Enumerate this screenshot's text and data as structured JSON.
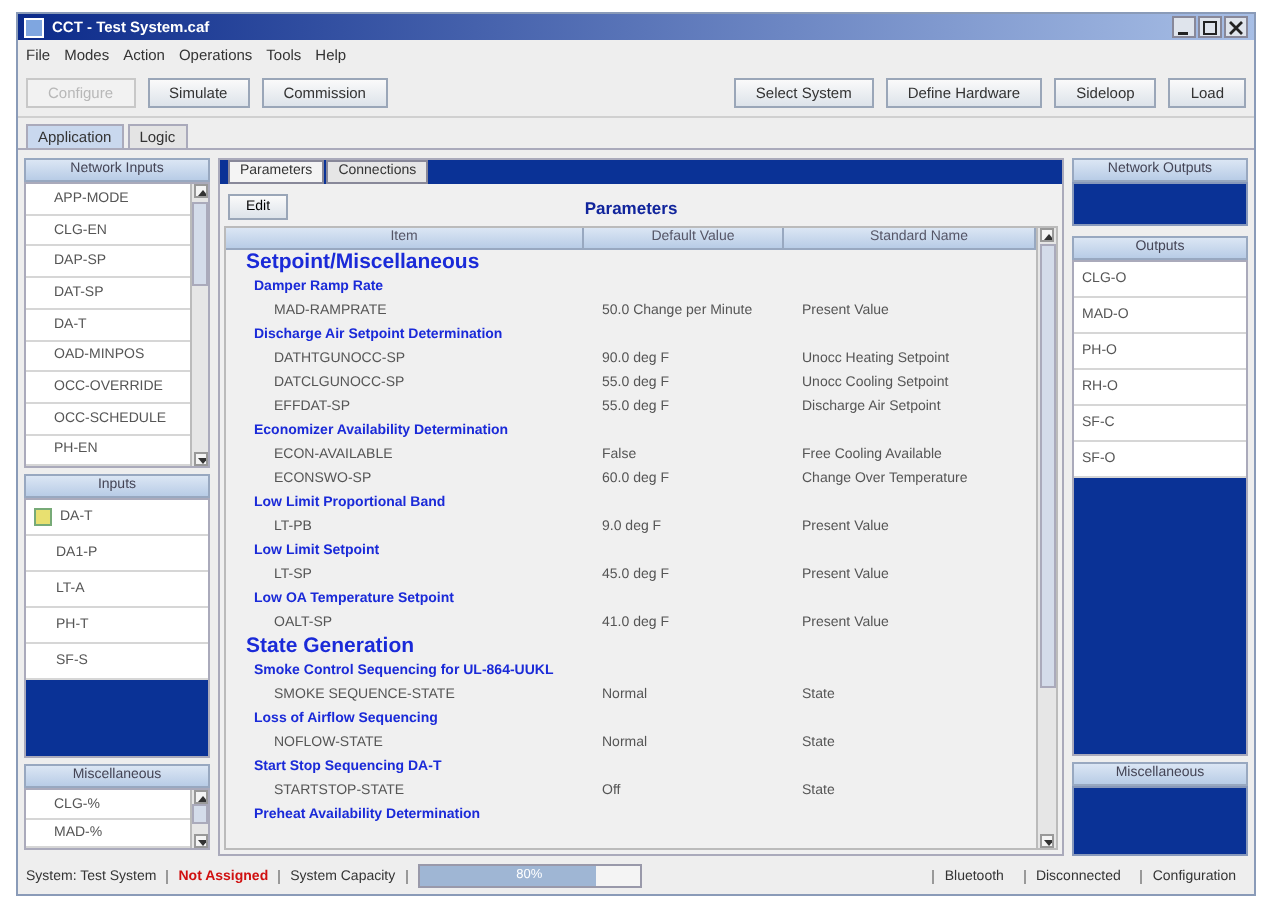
{
  "window": {
    "title": "CCT - Test System.caf"
  },
  "menu": [
    "File",
    "Modes",
    "Action",
    "Operations",
    "Tools",
    "Help"
  ],
  "toolbar_left": [
    {
      "label": "Configure",
      "disabled": true
    },
    {
      "label": "Simulate",
      "disabled": false
    },
    {
      "label": "Commission",
      "disabled": false
    }
  ],
  "toolbar_right": [
    "Select System",
    "Define Hardware",
    "Sideloop",
    "Load"
  ],
  "tabs": [
    {
      "label": "Application",
      "selected": true
    },
    {
      "label": "Logic",
      "selected": false
    }
  ],
  "left_panel": {
    "network_inputs": {
      "title": "Network Inputs",
      "items": [
        "APP-MODE",
        "CLG-EN",
        "DAP-SP",
        "DAT-SP",
        "DA-T",
        "OAD-MINPOS",
        "OCC-OVERRIDE",
        "OCC-SCHEDULE",
        "PH-EN"
      ]
    },
    "inputs": {
      "title": "Inputs",
      "items": [
        {
          "label": "DA-T",
          "flagged": true
        },
        {
          "label": "DA1-P",
          "flagged": false
        },
        {
          "label": "LT-A",
          "flagged": false
        },
        {
          "label": "PH-T",
          "flagged": false
        },
        {
          "label": "SF-S",
          "flagged": false
        }
      ]
    },
    "miscellaneous": {
      "title": "Miscellaneous",
      "items": [
        "CLG-%",
        "MAD-%"
      ]
    }
  },
  "center": {
    "tabs": [
      {
        "label": "Parameters",
        "selected": true
      },
      {
        "label": "Connections",
        "selected": false
      }
    ],
    "edit_button": "Edit",
    "title": "Parameters",
    "columns": [
      "Item",
      "Default Value",
      "Standard Name"
    ],
    "rows": [
      {
        "kind": "section",
        "item": "Setpoint/Miscellaneous"
      },
      {
        "kind": "group",
        "item": "Damper Ramp Rate"
      },
      {
        "kind": "item",
        "item": "MAD-RAMPRATE",
        "value": "50.0 Change per Minute",
        "standard": "Present Value"
      },
      {
        "kind": "group",
        "item": "Discharge Air Setpoint Determination"
      },
      {
        "kind": "item",
        "item": "DATHTGUNOCC-SP",
        "value": "90.0 deg F",
        "standard": "Unocc Heating Setpoint"
      },
      {
        "kind": "item",
        "item": "DATCLGUNOCC-SP",
        "value": "55.0 deg F",
        "standard": "Unocc Cooling Setpoint"
      },
      {
        "kind": "item",
        "item": "EFFDAT-SP",
        "value": "55.0 deg F",
        "standard": "Discharge Air Setpoint"
      },
      {
        "kind": "group",
        "item": "Economizer Availability Determination"
      },
      {
        "kind": "item",
        "item": "ECON-AVAILABLE",
        "value": "False",
        "standard": "Free Cooling Available"
      },
      {
        "kind": "item",
        "item": "ECONSWO-SP",
        "value": "60.0 deg F",
        "standard": "Change Over Temperature"
      },
      {
        "kind": "group",
        "item": "Low Limit Proportional Band"
      },
      {
        "kind": "item",
        "item": "LT-PB",
        "value": "9.0 deg F",
        "standard": "Present Value"
      },
      {
        "kind": "group",
        "item": "Low Limit Setpoint"
      },
      {
        "kind": "item",
        "item": "LT-SP",
        "value": "45.0 deg F",
        "standard": "Present Value"
      },
      {
        "kind": "group",
        "item": "Low OA Temperature Setpoint"
      },
      {
        "kind": "item",
        "item": "OALT-SP",
        "value": "41.0 deg F",
        "standard": "Present Value"
      },
      {
        "kind": "section",
        "item": "State Generation"
      },
      {
        "kind": "group",
        "item": "Smoke Control Sequencing for UL-864-UUKL"
      },
      {
        "kind": "item",
        "item": "SMOKE SEQUENCE-STATE",
        "value": "Normal",
        "standard": "State"
      },
      {
        "kind": "group",
        "item": "Loss of Airflow Sequencing"
      },
      {
        "kind": "item",
        "item": "NOFLOW-STATE",
        "value": "Normal",
        "standard": "State"
      },
      {
        "kind": "group",
        "item": "Start Stop Sequencing DA-T"
      },
      {
        "kind": "item",
        "item": "STARTSTOP-STATE",
        "value": "Off",
        "standard": "State"
      },
      {
        "kind": "group",
        "item": "Preheat Availability Determination"
      }
    ]
  },
  "right_panel": {
    "network_outputs": {
      "title": "Network Outputs"
    },
    "outputs": {
      "title": "Outputs",
      "items": [
        "CLG-O",
        "MAD-O",
        "PH-O",
        "RH-O",
        "SF-C",
        "SF-O"
      ]
    },
    "miscellaneous": {
      "title": "Miscellaneous"
    }
  },
  "status_bar": {
    "system": "System: Test System",
    "assignment": "Not Assigned",
    "capacity_label": "System Capacity",
    "capacity": {
      "level": 0.8,
      "reading": "80%"
    },
    "right": [
      "Bluetooth",
      "Disconnected",
      "Configuration"
    ]
  }
}
